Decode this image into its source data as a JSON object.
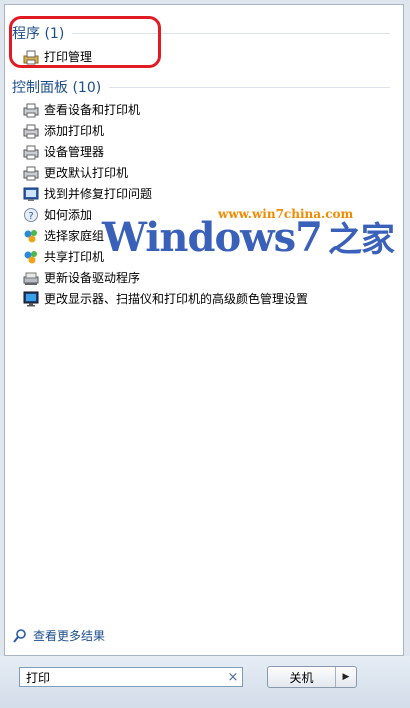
{
  "programs": {
    "header": "程序 (1)",
    "items": [
      {
        "label": "打印管理",
        "icon": "print-management-icon"
      }
    ]
  },
  "control_panel": {
    "header": "控制面板 (10)",
    "items": [
      {
        "label": "查看设备和打印机",
        "icon": "printer-icon"
      },
      {
        "label": "添加打印机",
        "icon": "printer-icon"
      },
      {
        "label": "设备管理器",
        "icon": "printer-icon"
      },
      {
        "label": "更改默认打印机",
        "icon": "printer-icon"
      },
      {
        "label": "找到并修复打印问题",
        "icon": "troubleshoot-icon"
      },
      {
        "label": "如何添加",
        "icon": "help-icon"
      },
      {
        "label": "选择家庭组",
        "icon": "homegroup-icon"
      },
      {
        "label": "共享打印机",
        "icon": "homegroup-icon"
      },
      {
        "label": "更新设备驱动程序",
        "icon": "device-driver-icon"
      },
      {
        "label": "更改显示器、扫描仪和打印机的高级颜色管理设置",
        "icon": "monitor-icon"
      }
    ]
  },
  "see_more": "查看更多结果",
  "search": {
    "value": "打印",
    "clear_symbol": "×"
  },
  "shutdown": {
    "label": "关机",
    "arrow": "▶"
  },
  "watermark": {
    "url": "www.win7china.com",
    "brand": "Windows7",
    "brand_cn": "之家"
  },
  "colors": {
    "header": "#1e4e8c",
    "highlight": "#e01b22",
    "watermark": "#2a54b5",
    "url": "#f08a00"
  }
}
